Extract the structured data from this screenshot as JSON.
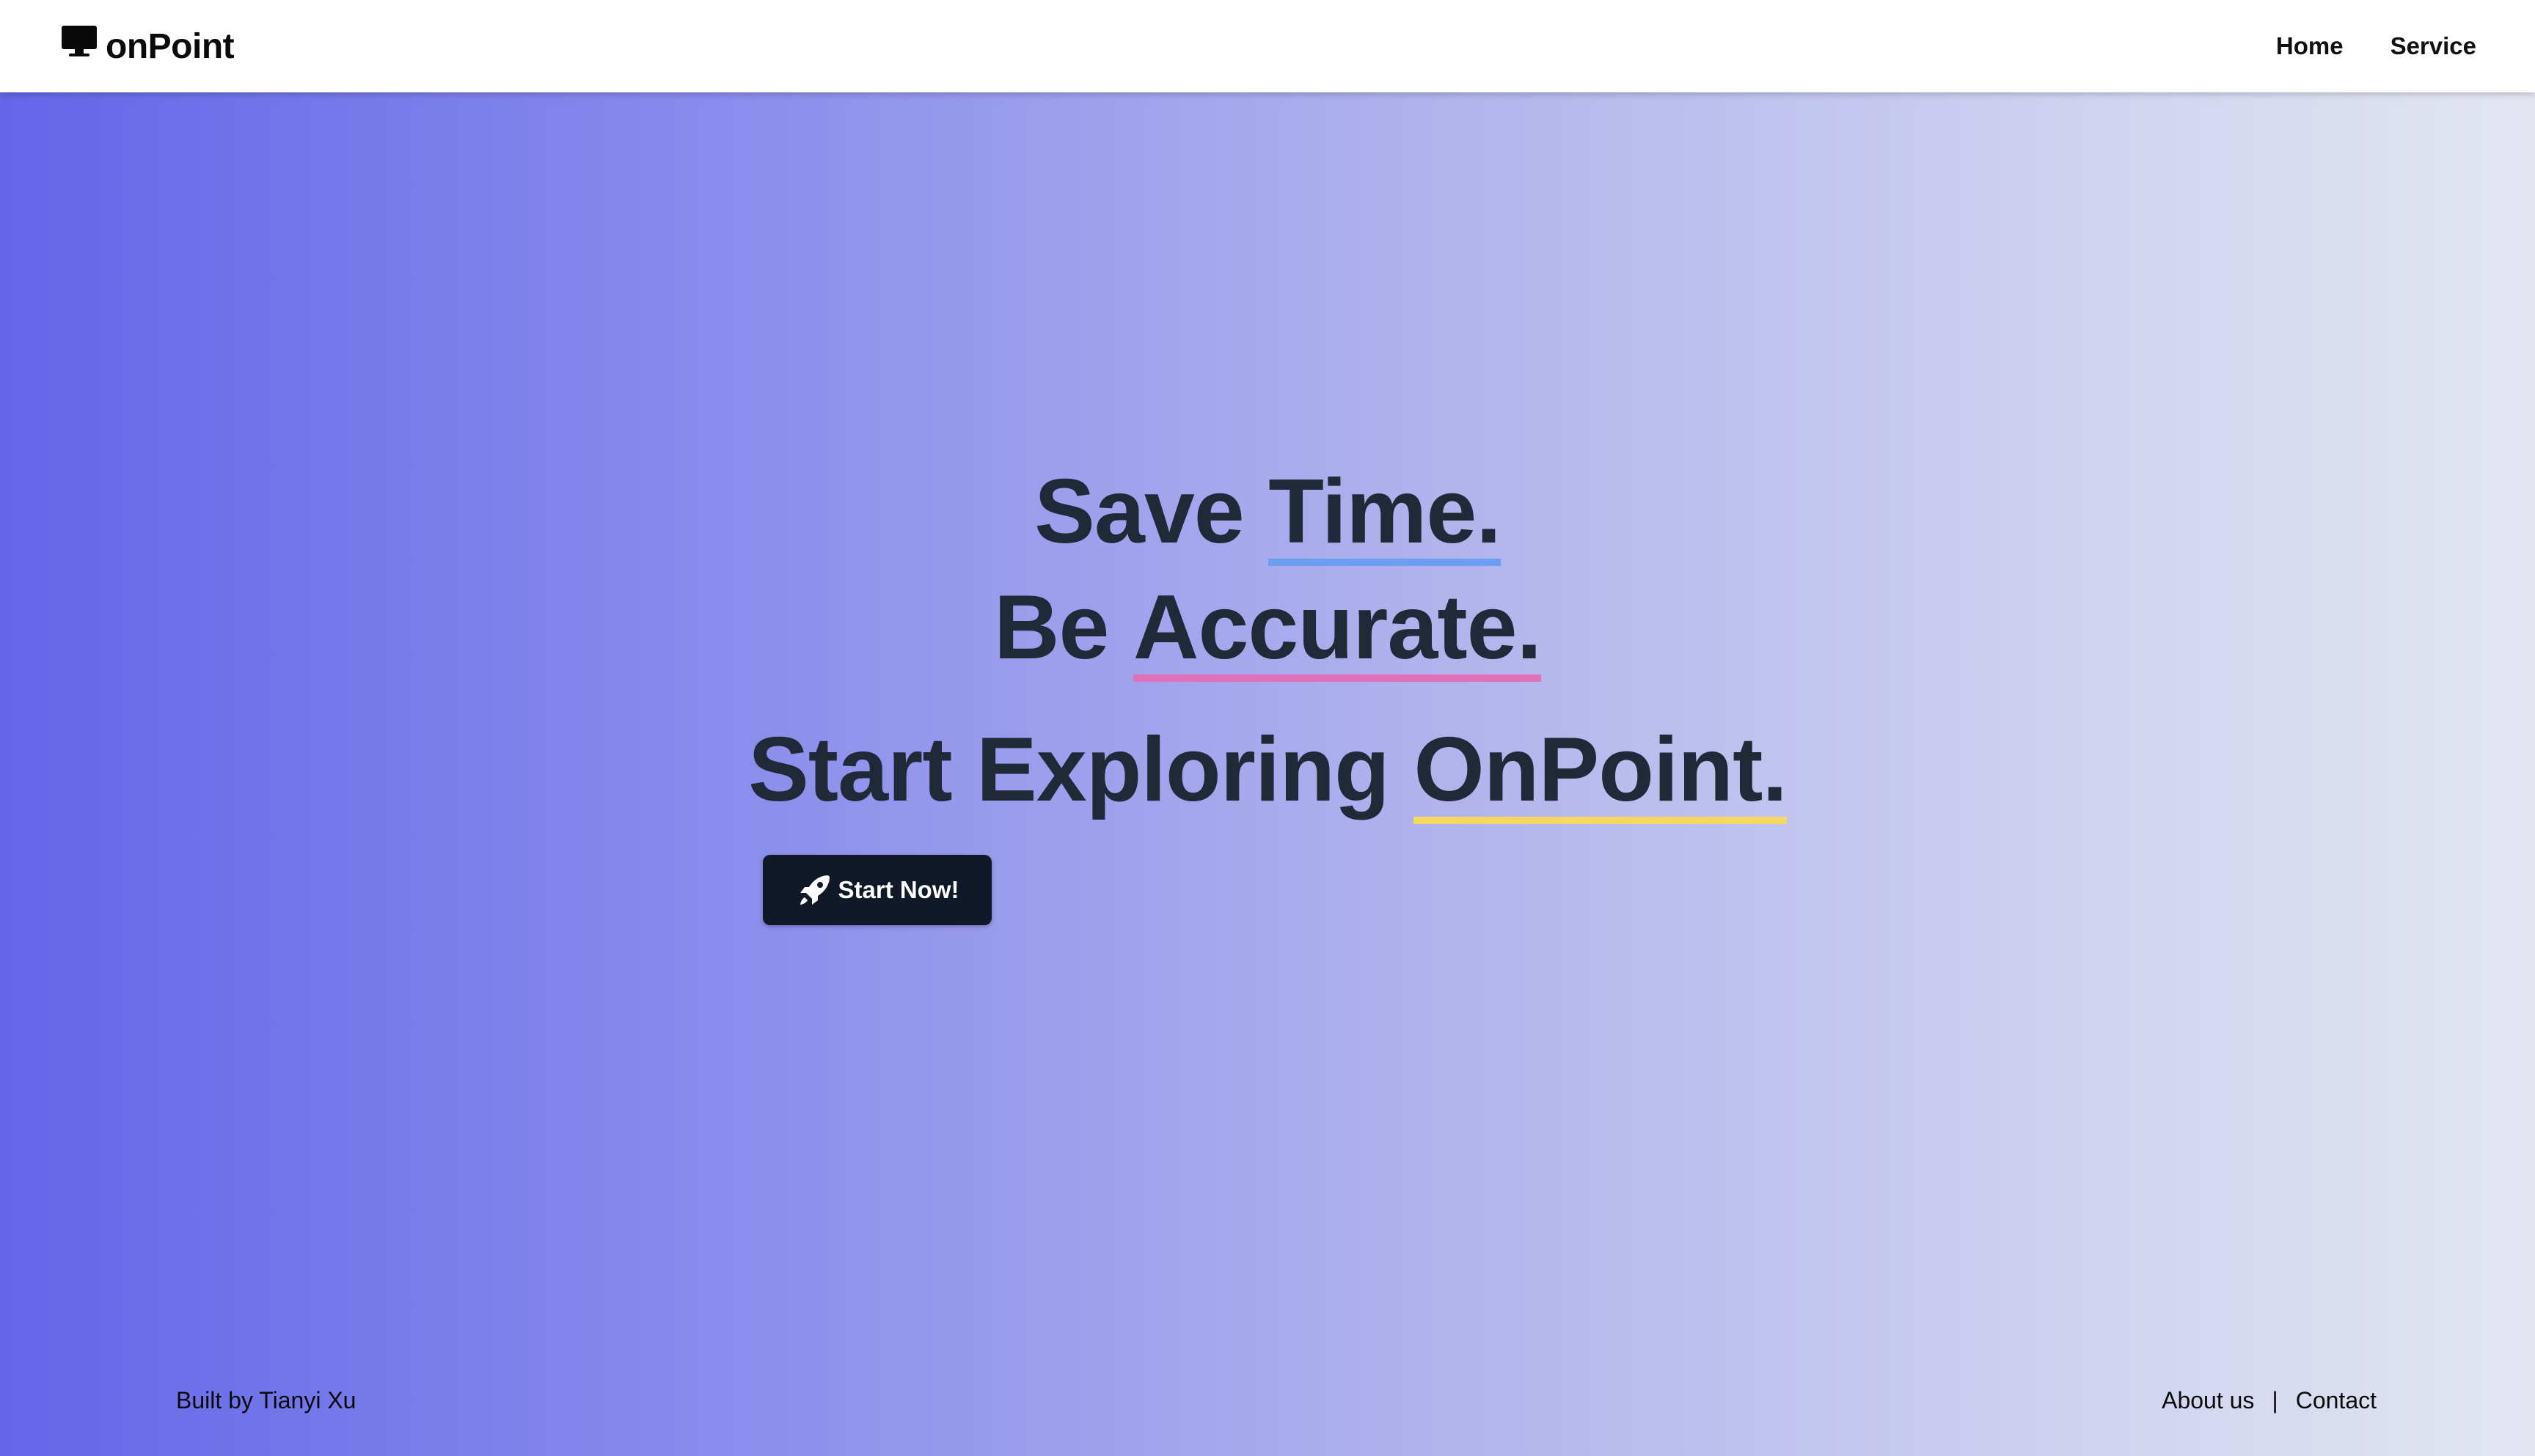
{
  "navbar": {
    "brand": "onPoint",
    "brand_icon": "monitor-icon",
    "links": [
      "Home",
      "Service"
    ]
  },
  "hero": {
    "line1": {
      "text": "Save ",
      "accent": "Time.",
      "accent_color": "#6b9ef0"
    },
    "line2": {
      "text": "Be ",
      "accent": "Accurate.",
      "accent_color": "#e070b8"
    },
    "line3": {
      "text": "Start Exploring ",
      "accent": "OnPoint.",
      "accent_color": "#f5d860"
    },
    "button": {
      "label": "Start Now!",
      "icon": "rocket-icon"
    }
  },
  "footer": {
    "credit": "Built by Tianyi Xu",
    "about": "About us",
    "separator": "|",
    "contact": "Contact"
  },
  "colors": {
    "gradient_start": "#6366e8",
    "gradient_end": "#e3e6f1",
    "headline": "#1f2937",
    "button_bg": "#111827"
  }
}
